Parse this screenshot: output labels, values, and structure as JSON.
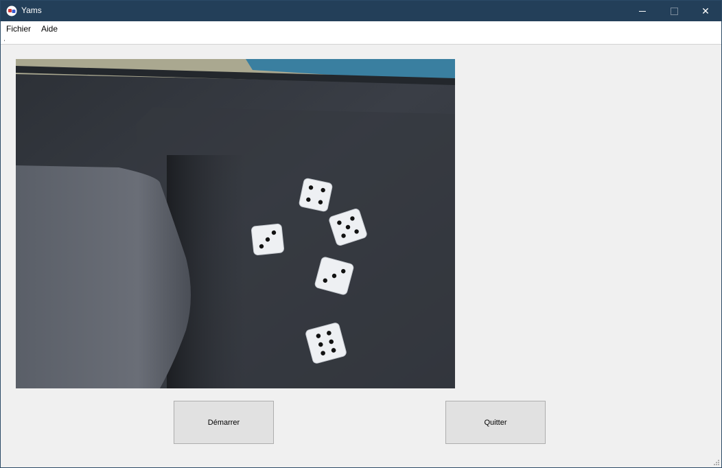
{
  "window": {
    "title": "Yams",
    "app_icon": "yams-app-icon",
    "controls": {
      "minimize_icon": "minimize-icon",
      "maximize_icon": "maximize-icon",
      "close_icon": "close-icon",
      "close_glyph": "✕"
    }
  },
  "menu": {
    "items": [
      {
        "label": "Fichier"
      },
      {
        "label": "Aide"
      }
    ]
  },
  "camera_view": {
    "description_icon": "camera-feed",
    "dice_faces": [
      4,
      3,
      5,
      3,
      6
    ]
  },
  "buttons": {
    "start_label": "Démarrer",
    "quit_label": "Quitter"
  },
  "colors": {
    "titlebar": "#233f59",
    "window_bg": "#f0f0f0",
    "button_bg": "#e1e1e1",
    "table_felt": "#34383f"
  }
}
